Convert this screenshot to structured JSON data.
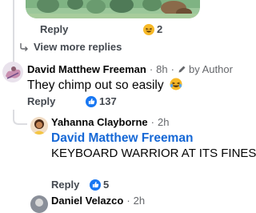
{
  "top_comment": {
    "reply_label": "Reply",
    "reaction_count": "2"
  },
  "view_more": {
    "label": "View more replies"
  },
  "comment_david": {
    "author": "David Matthew Freeman",
    "time": "8h",
    "dot": "·",
    "badge": "by Author",
    "text": "They chimp out so easily",
    "reply_label": "Reply",
    "like_count": "137"
  },
  "comment_yahanna": {
    "author": "Yahanna Clayborne",
    "time": "2h",
    "dot": "·",
    "mention": "David Matthew Freeman",
    "text": "KEYBOARD WARRIOR AT ITS FINEST.",
    "reply_label": "Reply",
    "like_count": "5"
  },
  "comment_next": {
    "author": "Daniel Velazco",
    "time": "2h",
    "dot": "·"
  },
  "colors": {
    "accent": "#1877f2",
    "mention": "#1668d6",
    "muted": "#65676b"
  }
}
